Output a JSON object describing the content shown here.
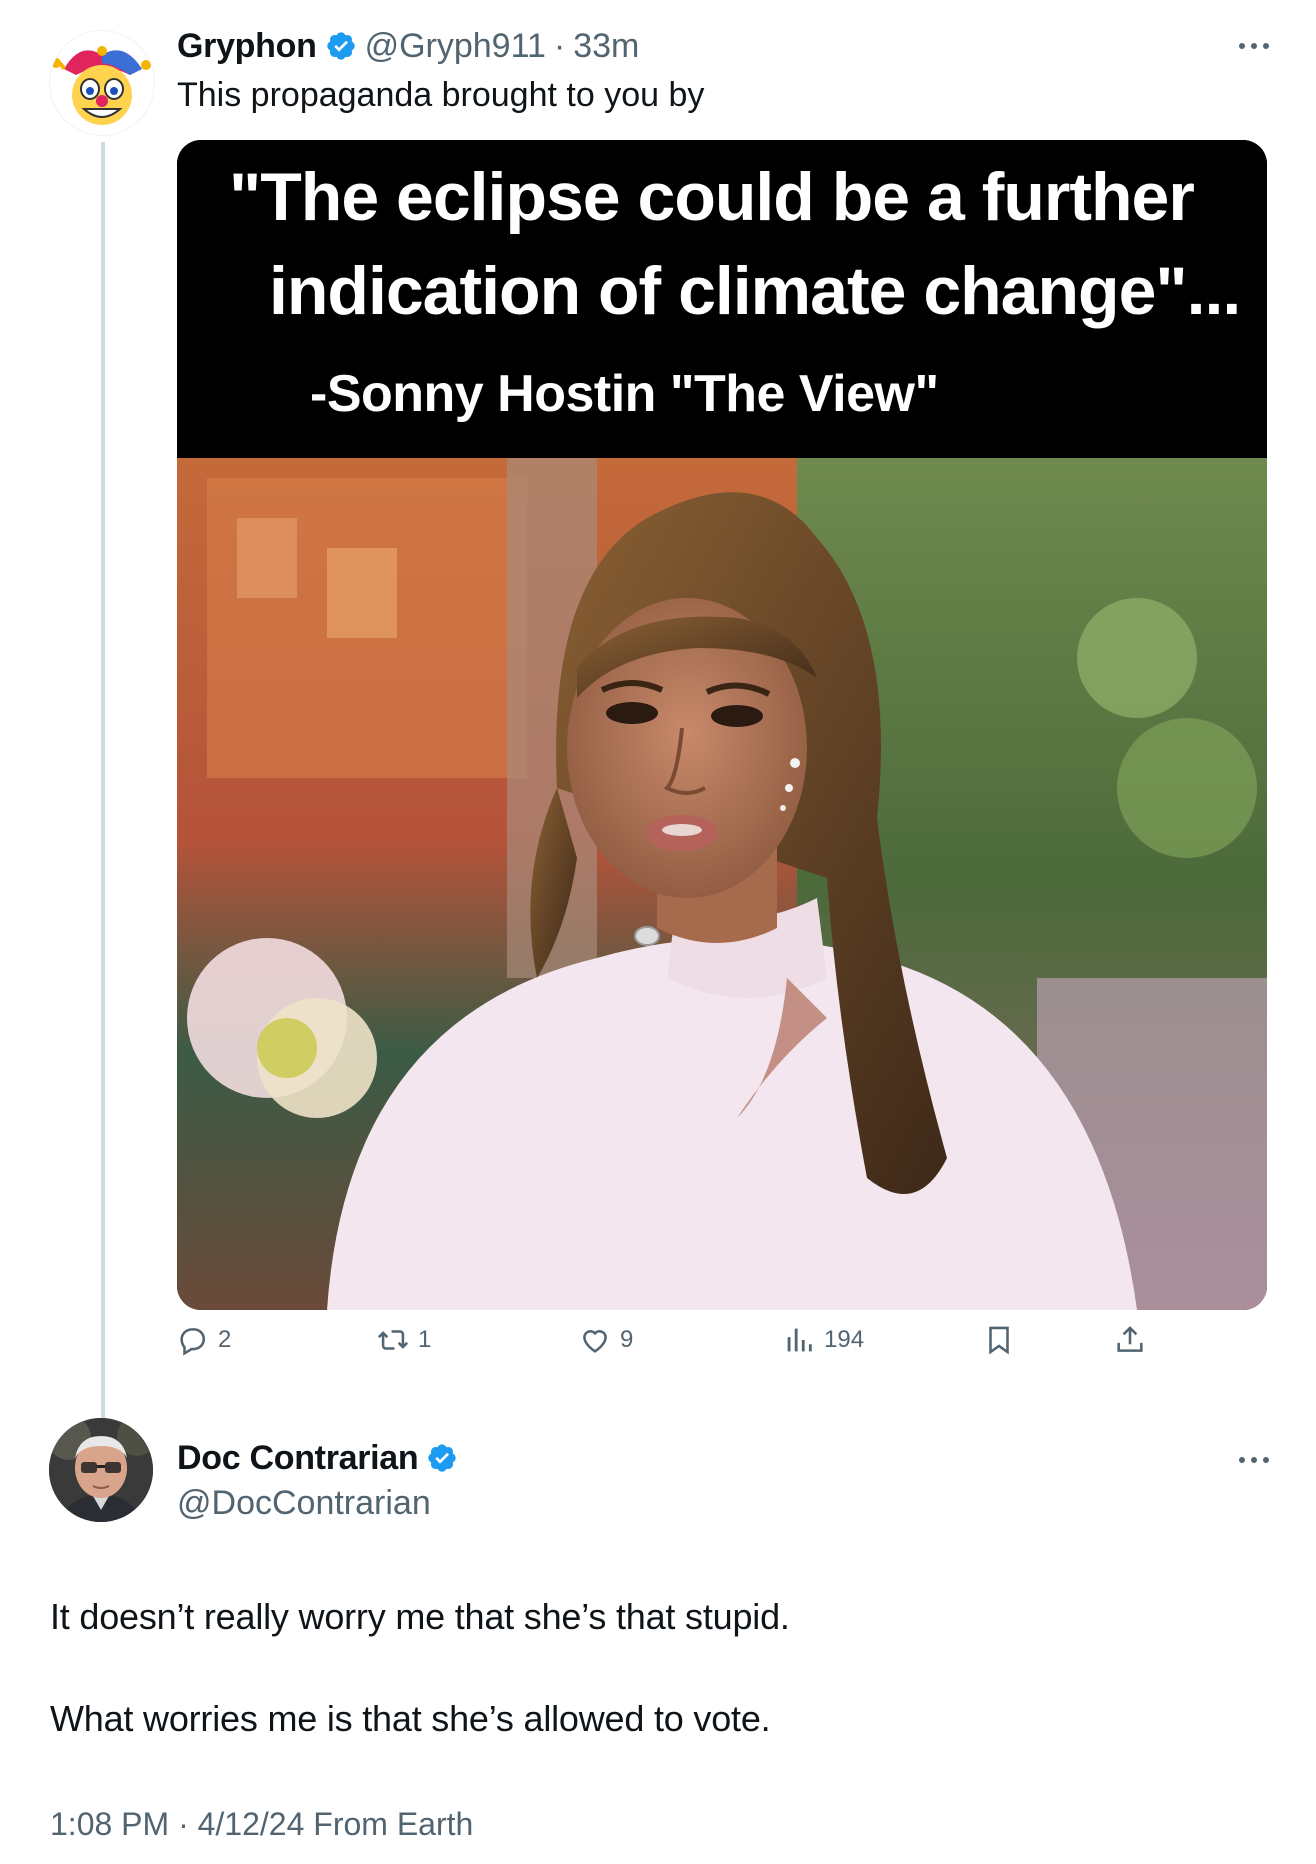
{
  "tweet1": {
    "author_name": "Gryphon",
    "handle": "@Gryph911",
    "separator": "·",
    "time_ago": "33m",
    "text": "This propaganda brought to you by",
    "avatar_icon": "jester-emoji-icon",
    "media": {
      "quote_line_1": "\"The eclipse could be a further",
      "quote_line_2": "indication of climate change\"...",
      "attribution": "-Sonny Hostin \"The View\""
    },
    "actions": {
      "replies": "2",
      "reposts": "1",
      "likes": "9",
      "views": "194"
    }
  },
  "tweet2": {
    "author_name": "Doc Contrarian",
    "handle": "@DocContrarian",
    "avatar_icon": "man-with-glasses-avatar",
    "text_line_1": "It doesn’t really worry me that she’s that stupid.",
    "text_line_2": "What worries me is that she’s allowed to vote.",
    "timestamp": "1:08 PM · 4/12/24 From Earth"
  },
  "colors": {
    "verified": "#1d9bf0",
    "muted": "#536471",
    "thread_line": "#cfd9de",
    "text": "#0f1419"
  }
}
